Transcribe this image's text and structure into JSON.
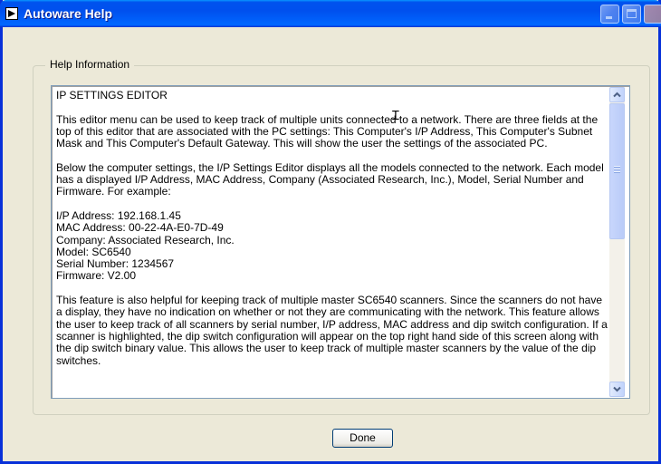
{
  "window": {
    "title": "Autoware Help",
    "icon": "labview-run-icon"
  },
  "titlebar_buttons": [
    "minimize",
    "maximize",
    "close"
  ],
  "group": {
    "label": "Help Information"
  },
  "help_text": "IP SETTINGS EDITOR\n\nThis editor menu can be used to keep track of multiple units connected to a network. There are three fields at the top of this editor that are associated with the PC settings: This Computer's I/P Address, This Computer's Subnet Mask and This Computer's Default Gateway. This will show the user the settings of the associated PC.\n\nBelow the computer settings, the I/P Settings Editor displays all the models connected to the network. Each model has a displayed I/P Address, MAC Address, Company (Associated Research, Inc.), Model, Serial Number and Firmware. For example:\n\nI/P Address: 192.168.1.45\nMAC Address: 00-22-4A-E0-7D-49\nCompany: Associated Research, Inc.\nModel: SC6540\nSerial Number: 1234567\nFirmware: V2.00\n\nThis feature is also helpful for keeping track of multiple master SC6540 scanners. Since the scanners do not have a display, they have no indication on whether or not they are communicating with the network. This feature allows the user to keep track of all scanners by serial number, I/P address, MAC address and dip switch configuration. If a scanner is highlighted, the dip switch configuration will appear on the top right hand side of this screen along with the dip switch binary value. This allows the user to keep track of multiple master scanners by the value of the dip switches.",
  "buttons": {
    "done": "Done"
  },
  "colors": {
    "titlebar": "#0053ee",
    "face": "#ece9d8",
    "border": "#0831d9"
  }
}
